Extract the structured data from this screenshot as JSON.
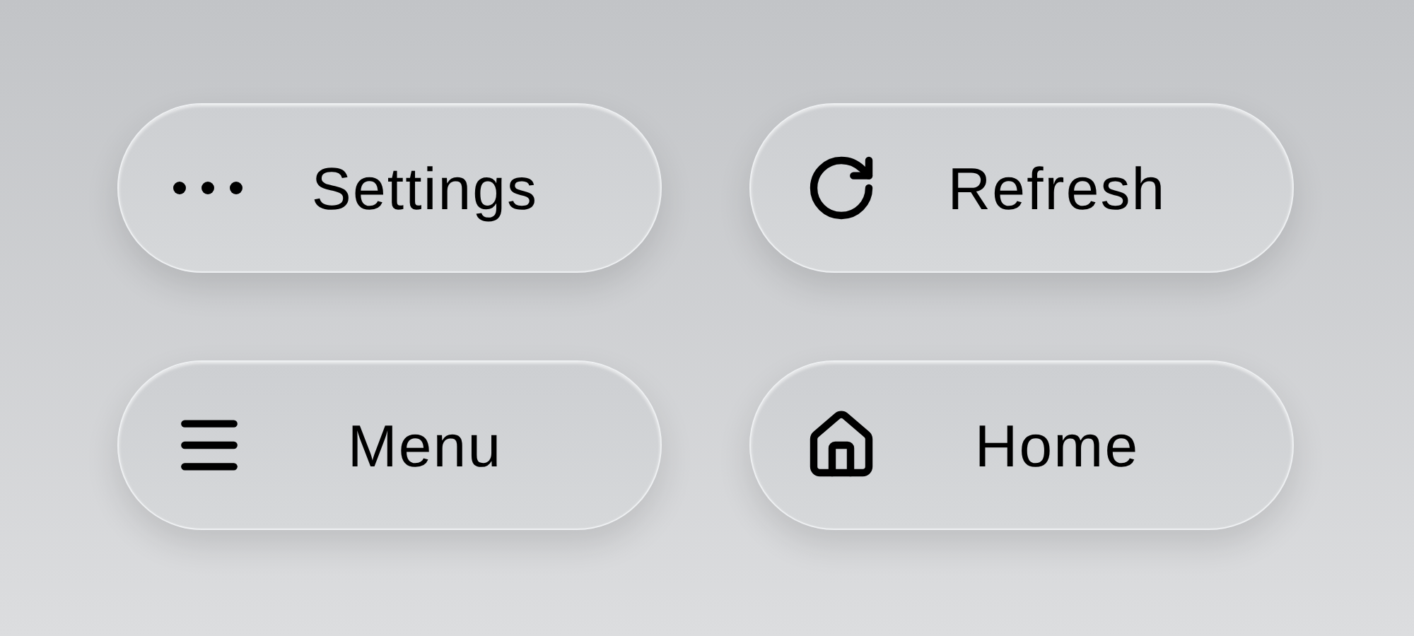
{
  "buttons": [
    {
      "label": "Settings"
    },
    {
      "label": "Refresh"
    },
    {
      "label": "Menu"
    },
    {
      "label": "Home"
    }
  ]
}
